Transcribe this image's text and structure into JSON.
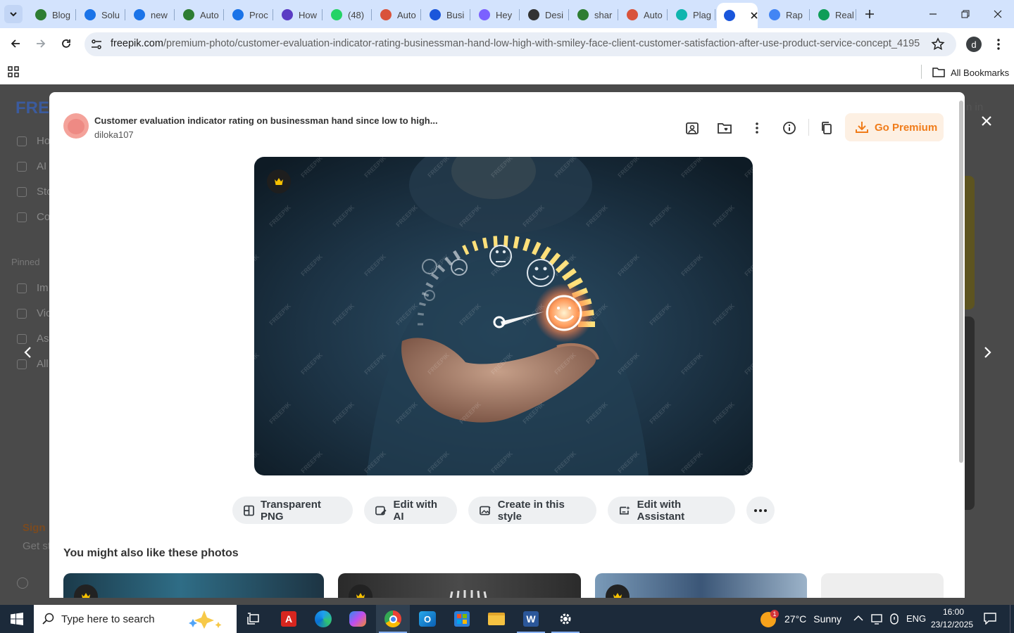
{
  "browser": {
    "tabs": [
      {
        "label": "Blog",
        "icon": "autoblog-icon",
        "color": "#2e7d32"
      },
      {
        "label": "Solu",
        "icon": "chatgpt-icon",
        "color": "#1a73e8"
      },
      {
        "label": "new",
        "icon": "chatgpt-icon",
        "color": "#1a73e8"
      },
      {
        "label": "Auto",
        "icon": "autoblog-icon",
        "color": "#2e7d32"
      },
      {
        "label": "Proc",
        "icon": "chatgpt-icon",
        "color": "#1a73e8"
      },
      {
        "label": "How",
        "icon": "chat-icon",
        "color": "#5b3cc4"
      },
      {
        "label": "(48)",
        "icon": "whatsapp-icon",
        "color": "#25d366"
      },
      {
        "label": "Auto",
        "icon": "claude-icon",
        "color": "#d9533b"
      },
      {
        "label": "Busi",
        "icon": "docs-icon",
        "color": "#1a56db"
      },
      {
        "label": "Hey",
        "icon": "gemini-icon",
        "color": "#7b61ff"
      },
      {
        "label": "Desi",
        "icon": "design-icon",
        "color": "#333333"
      },
      {
        "label": "shar",
        "icon": "autoblog-icon",
        "color": "#2e7d32"
      },
      {
        "label": "Auto",
        "icon": "claude-icon",
        "color": "#d9533b"
      },
      {
        "label": "Plag",
        "icon": "plagiarism-icon",
        "color": "#0fb5ae"
      },
      {
        "label": "",
        "icon": "freepik-icon",
        "color": "#1a56db",
        "active": true
      },
      {
        "label": "Rap",
        "icon": "google-icon",
        "color": "#4285f4"
      },
      {
        "label": "Real",
        "icon": "sheets-icon",
        "color": "#0f9d58"
      }
    ],
    "url_host": "freepik.com",
    "url_path": "/premium-photo/customer-evaluation-indicator-rating-businessman-hand-low-high-with-smiley-face-client-customer-satisfaction-after-use-product-service-concept_41955...",
    "profile_initial": "d",
    "all_bookmarks": "All Bookmarks"
  },
  "background_page": {
    "logo": "FRE",
    "sign_in": "n in",
    "nav": [
      "Ho",
      "AI",
      "Sto",
      "Co"
    ],
    "pinned_label": "Pinned",
    "pinned": [
      "Im",
      "Vic",
      "As",
      "All"
    ],
    "sign_up": "Sign",
    "get_started": "Get st"
  },
  "modal": {
    "title": "Customer evaluation indicator rating on businessman hand since low to high...",
    "author": "diloka107",
    "go_premium": "Go Premium",
    "watermark": "FREEPIK",
    "actions": [
      {
        "label": "Transparent PNG",
        "icon": "transparent-png-icon"
      },
      {
        "label": "Edit with AI",
        "icon": "edit-ai-icon"
      },
      {
        "label": "Create in this style",
        "icon": "image-style-icon"
      },
      {
        "label": "Edit with Assistant",
        "icon": "assistant-icon"
      }
    ],
    "related_heading": "You might also like these photos"
  },
  "taskbar": {
    "search_placeholder": "Type here to search",
    "weather_temp": "27°C",
    "weather_text": "Sunny",
    "weather_badge": "1",
    "language": "ENG",
    "time": "16:00",
    "date": "23/12/2025"
  }
}
